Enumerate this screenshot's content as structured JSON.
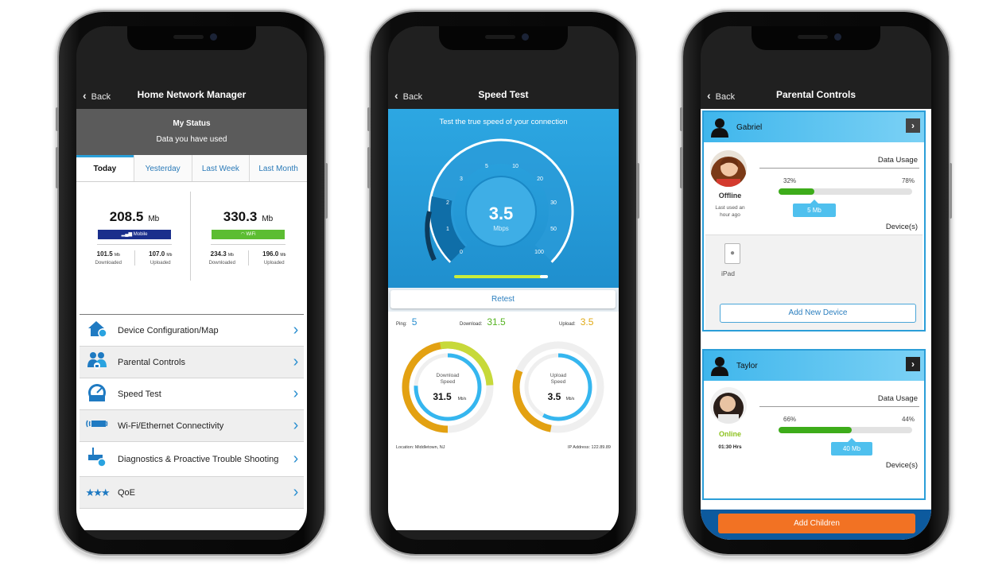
{
  "phone1": {
    "back": "Back",
    "title": "Home Network Manager",
    "status_title": "My Status",
    "status_sub": "Data you have used",
    "tabs": [
      "Today",
      "Yesterday",
      "Last Week",
      "Last Month"
    ],
    "mobile": {
      "value": "208.5",
      "unit": "Mb",
      "badge": "Mobile",
      "down": "101.5",
      "up": "107.0",
      "sub_unit": "Mb",
      "down_label": "Downloaded",
      "up_label": "Uploaded"
    },
    "wifi": {
      "value": "330.3",
      "unit": "Mb",
      "badge": "WiFi",
      "down": "234.3",
      "up": "196.0",
      "sub_unit": "Mb",
      "down_label": "Downloaded",
      "up_label": "Uploaded"
    },
    "menu": [
      {
        "label": "Device Configuration/Map",
        "icon": "house-gear-icon"
      },
      {
        "label": "Parental Controls",
        "icon": "family-lock-icon"
      },
      {
        "label": "Speed Test",
        "icon": "speedometer-icon"
      },
      {
        "label": "Wi-Fi/Ethernet Connectivity",
        "icon": "wifi-router-icon"
      },
      {
        "label": "Diagnostics & Proactive Trouble Shooting",
        "icon": "router-diagnostics-icon"
      },
      {
        "label": "QoE",
        "icon": "stars-icon"
      }
    ],
    "colors": {
      "mobile": "#1a2f8c",
      "wifi": "#5cbd32",
      "accent": "#2a9fd8"
    }
  },
  "phone2": {
    "back": "Back",
    "title": "Speed Test",
    "caption": "Test the true speed of your connection",
    "gauge": {
      "value": "3.5",
      "unit": "Mbps",
      "ticks": [
        "0",
        "1",
        "2",
        "3",
        "5",
        "10",
        "20",
        "30",
        "50",
        "100"
      ]
    },
    "retest": "Retest",
    "ping_label": "Ping:",
    "ping": "5",
    "download_label": "Download:",
    "download": "31.5",
    "upload_label": "Upload:",
    "upload": "3.5",
    "download_dial": {
      "line1": "Download",
      "line2": "Speed",
      "value": "31.5",
      "unit": "Mb/s"
    },
    "upload_dial": {
      "line1": "Upload",
      "line2": "Speed",
      "value": "3.5",
      "unit": "Mb/s"
    },
    "location": "Location: Middletown, NJ",
    "ip": "IP Address: 122.89.89",
    "colors": {
      "ping": "#2a8fd0",
      "download": "#55b321",
      "upload": "#e0a915"
    }
  },
  "phone3": {
    "back": "Back",
    "title": "Parental Controls",
    "children": [
      {
        "name": "Gabriel",
        "state": "Offline",
        "detail1": "Last used an",
        "detail2": "hour ago",
        "data_usage": "Data Usage",
        "pct_left": "32%",
        "pct_right": "78%",
        "fill": 0.27,
        "tip": "5 Mb",
        "devices_label": "Device(s)",
        "device": "iPad",
        "add_device": "Add New Device"
      },
      {
        "name": "Taylor",
        "state": "Online",
        "detail1": "01:30 Hrs",
        "data_usage": "Data Usage",
        "pct_left": "66%",
        "pct_right": "44%",
        "fill": 0.55,
        "tip": "40 Mb",
        "devices_label": "Device(s)"
      }
    ],
    "add_children": "Add Children",
    "colors": {
      "offline": "#333333",
      "online": "#8dc21f",
      "add": "#f27223"
    }
  }
}
